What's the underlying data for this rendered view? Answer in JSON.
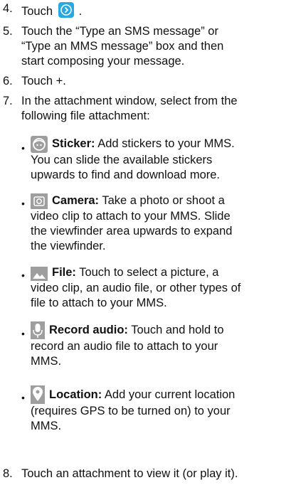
{
  "steps": [
    {
      "num": "4.",
      "text": "Touch",
      "icon": "forward-arrow-icon"
    },
    {
      "num": "5.",
      "line1": "Touch the “Type an SMS message” or",
      "line2": "“Type an MMS message” box and then",
      "line3": "start composing your message."
    },
    {
      "num": "6.",
      "text": "Touch +."
    },
    {
      "num": "7.",
      "line1": "In the attachment window, select from the",
      "line2": "following file attachment:"
    },
    {
      "num": "8.",
      "text": "Touch an attachment to view it (or play it)."
    }
  ],
  "attachments": [
    {
      "icon": "sticker-icon",
      "title": "Sticker:",
      "line1": " Add stickers to your MMS.",
      "line2": "You can slide the available stickers",
      "line3": "upwards to find and download more."
    },
    {
      "icon": "camera-icon",
      "title": "Camera:",
      "line1": " Take a photo or shoot a",
      "line2": "video clip to attach to your MMS. Slide",
      "line3": "the viewfinder area upwards to expand",
      "line4": "the viewfinder."
    },
    {
      "icon": "picture-file-icon",
      "title": "File:",
      "line1": " Touch to select a picture, a",
      "line2": "video clip, an audio file, or other types of",
      "line3": "file to attach to your MMS."
    },
    {
      "icon": "microphone-icon",
      "title": "Record audio:",
      "line1": " Touch and hold to",
      "line2": "record an audio file to attach to your",
      "line3": "MMS."
    },
    {
      "icon": "location-pin-icon",
      "title": "Location:",
      "line1": " Add your current location",
      "line2": "(requires GPS to be turned on) to your",
      "line3": "MMS."
    }
  ],
  "colors": {
    "forward_icon": "#26a9e0",
    "attachment_icon_bg": "#9e9e9e",
    "attachment_icon_fg": "#ffffff"
  }
}
